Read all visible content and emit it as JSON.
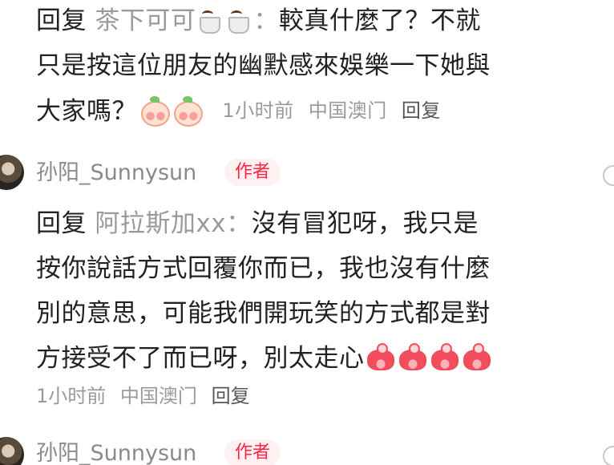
{
  "comments": [
    {
      "reply_keyword": "回复",
      "mention": "茶下可可",
      "colon": "：",
      "lines": [
        "較真什麼了？不就",
        "只是按這位朋友的幽默感來娛樂一下她與",
        "大家嗎？"
      ],
      "emoji_mention": [
        "coffee-emoji",
        "coffee-emoji"
      ],
      "emoji_end": [
        "peach-emoji",
        "peach-emoji"
      ],
      "meta": {
        "time": "1小时前",
        "location": "中国澳门",
        "reply": "回复"
      }
    },
    {
      "author": "孙阳_Sunnysun",
      "badge": "作者",
      "reply_keyword": "回复",
      "mention": "阿拉斯加xx",
      "colon": "：",
      "lines": [
        "沒有冒犯呀，我只是",
        "按你說話方式回覆你而已，我也沒有什麼",
        "別的意思，可能我們開玩笑的方式都是對",
        "方接受不了而已呀，別太走心"
      ],
      "emoji_end": [
        "pig-emoji",
        "pig-emoji",
        "pig-emoji",
        "pig-emoji"
      ],
      "meta": {
        "time": "1小时前",
        "location": "中国澳门",
        "reply": "回复"
      }
    },
    {
      "author": "孙阳_Sunnysun",
      "badge": "作者"
    }
  ],
  "colors": {
    "badge_text": "#ff2442",
    "badge_bg": "#fff0f2",
    "mention": "#9a9a9a",
    "body_text": "#222222"
  }
}
